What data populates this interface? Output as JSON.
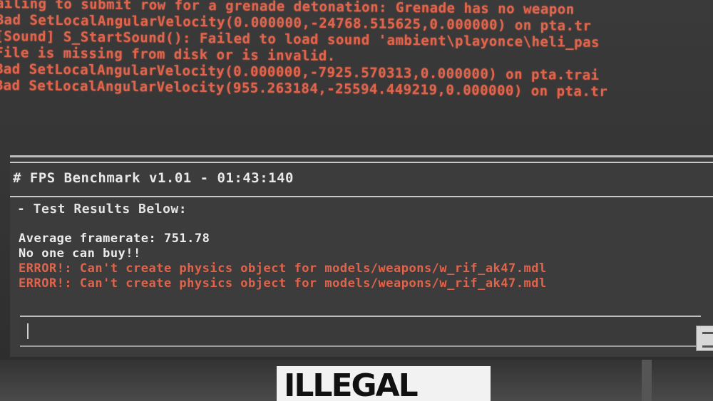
{
  "log": {
    "lines": [
      "ailing to submit row for a grenade detonation: Grenade has no weapon",
      "Bad SetLocalAngularVelocity(0.000000,-24768.515625,0.000000) on pta.tr",
      "[Sound] S_StartSound(): Failed to load sound 'ambient\\playonce\\heli_pas",
      "File is missing from disk or is invalid.",
      "Bad SetLocalAngularVelocity(0.000000,-7925.570313,0.000000) on pta.trai",
      "Bad SetLocalAngularVelocity(955.263184,-25594.449219,0.000000) on pta.tr"
    ]
  },
  "console": {
    "title": "# FPS Benchmark v1.01 - 01:43:140",
    "subtitle": "- Test Results Below:",
    "output": [
      {
        "text": "Average framerate: 751.78",
        "type": "normal"
      },
      {
        "text": "No one can buy!!",
        "type": "normal"
      },
      {
        "text": "ERROR!: Can't create physics object for models/weapons/w_rif_ak47.mdl",
        "type": "error"
      },
      {
        "text": "ERROR!: Can't create physics object for models/weapons/w_rif_ak47.mdl",
        "type": "error"
      }
    ],
    "input_value": ""
  },
  "sticker": {
    "text": "ILLEGAL"
  },
  "colors": {
    "error": "#e0644c",
    "text": "#ececec",
    "background": "#3a3a3a"
  }
}
